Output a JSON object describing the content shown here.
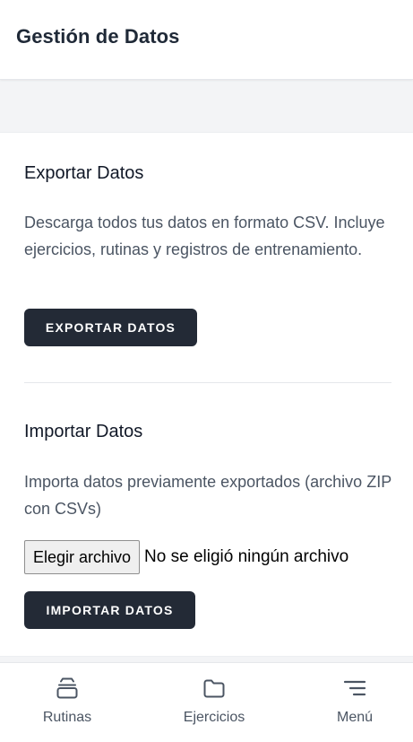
{
  "header": {
    "title": "Gestión de Datos"
  },
  "export": {
    "title": "Exportar Datos",
    "description": "Descarga todos tus datos en formato CSV. Incluye ejercicios, rutinas y registros de entrenamiento.",
    "button_label": "EXPORTAR DATOS"
  },
  "import": {
    "title": "Importar Datos",
    "description": "Importa datos previamente exportados (archivo ZIP con CSVs)",
    "file_button_label": "Elegir archivo",
    "file_status": "No se eligió ningún archivo",
    "button_label": "IMPORTAR DATOS"
  },
  "nav": {
    "items": [
      {
        "label": "Rutinas",
        "icon": "stack-icon"
      },
      {
        "label": "Ejercicios",
        "icon": "folder-icon"
      },
      {
        "label": "Menú",
        "icon": "menu-icon"
      }
    ]
  },
  "colors": {
    "button_bg": "#232a36",
    "text_primary": "#1f2937",
    "text_secondary": "#4b5563",
    "page_bg": "#f3f4f6"
  }
}
